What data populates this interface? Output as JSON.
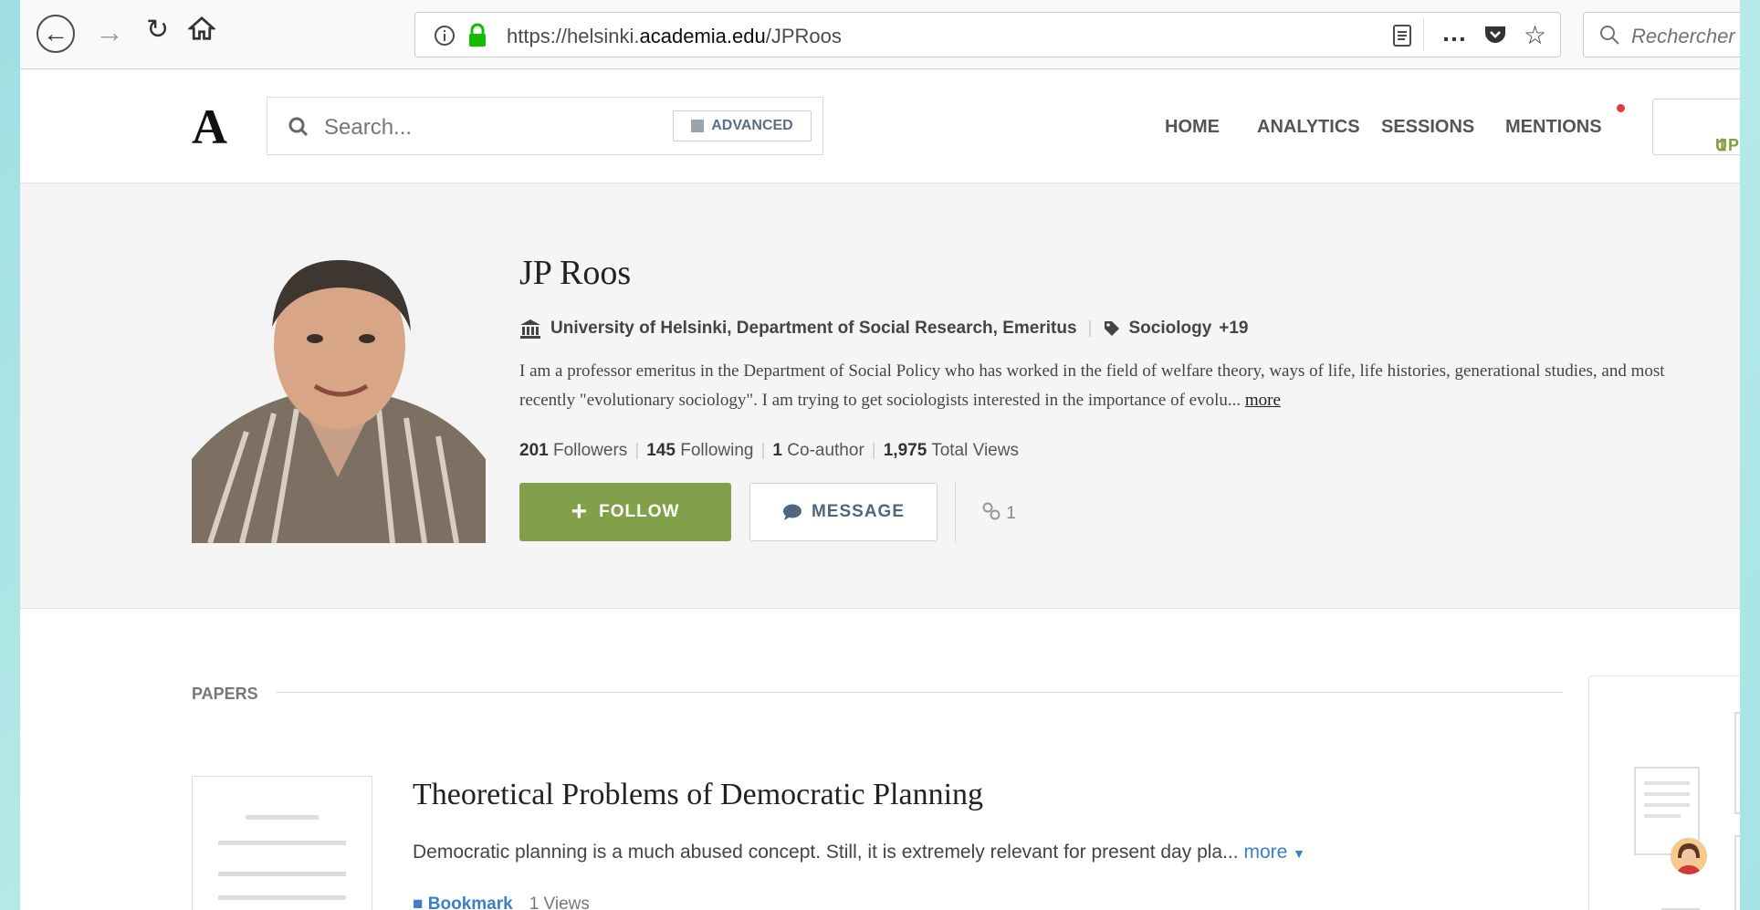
{
  "browser": {
    "url_prefix": "https://helsinki.",
    "url_domain": "academia.edu",
    "url_path": "/JPRoos",
    "search_placeholder": "Rechercher",
    "more_label": "…"
  },
  "site": {
    "logo": "A",
    "search_placeholder": "Search...",
    "advanced_label": "ADVANCED",
    "nav": [
      "HOME",
      "ANALYTICS",
      "SESSIONS",
      "MENTIONS"
    ],
    "upload_label": "UPL"
  },
  "profile": {
    "name": "JP Roos",
    "affiliation": "University of Helsinki, Department of Social Research, Emeritus",
    "topic": "Sociology",
    "topic_extra": "+19",
    "bio": "I am a professor  emeritus in the Department of Social Policy who has worked in the field of welfare theory, ways of life, life histories, generational studies, and most recently \"evolutionary sociology\". I am trying to get sociologists interested in the importance of evolu...",
    "bio_more": "more",
    "followers_count": "201",
    "followers_label": "Followers",
    "following_count": "145",
    "following_label": "Following",
    "coauthor_count": "1",
    "coauthor_label": "Co-author",
    "views_count": "1,975",
    "views_label": "Total Views",
    "follow_label": "FOLLOW",
    "message_label": "MESSAGE",
    "coauthor_link_count": "1"
  },
  "papers": {
    "section_label": "PAPERS",
    "items": [
      {
        "title": "Theoretical Problems of Democratic Planning",
        "abstract": "Democratic planning is a much abused concept. Still, it is extremely relevant for present day pla...",
        "more": "more",
        "bookmark": "Bookmark",
        "views": "1 Views"
      }
    ]
  }
}
